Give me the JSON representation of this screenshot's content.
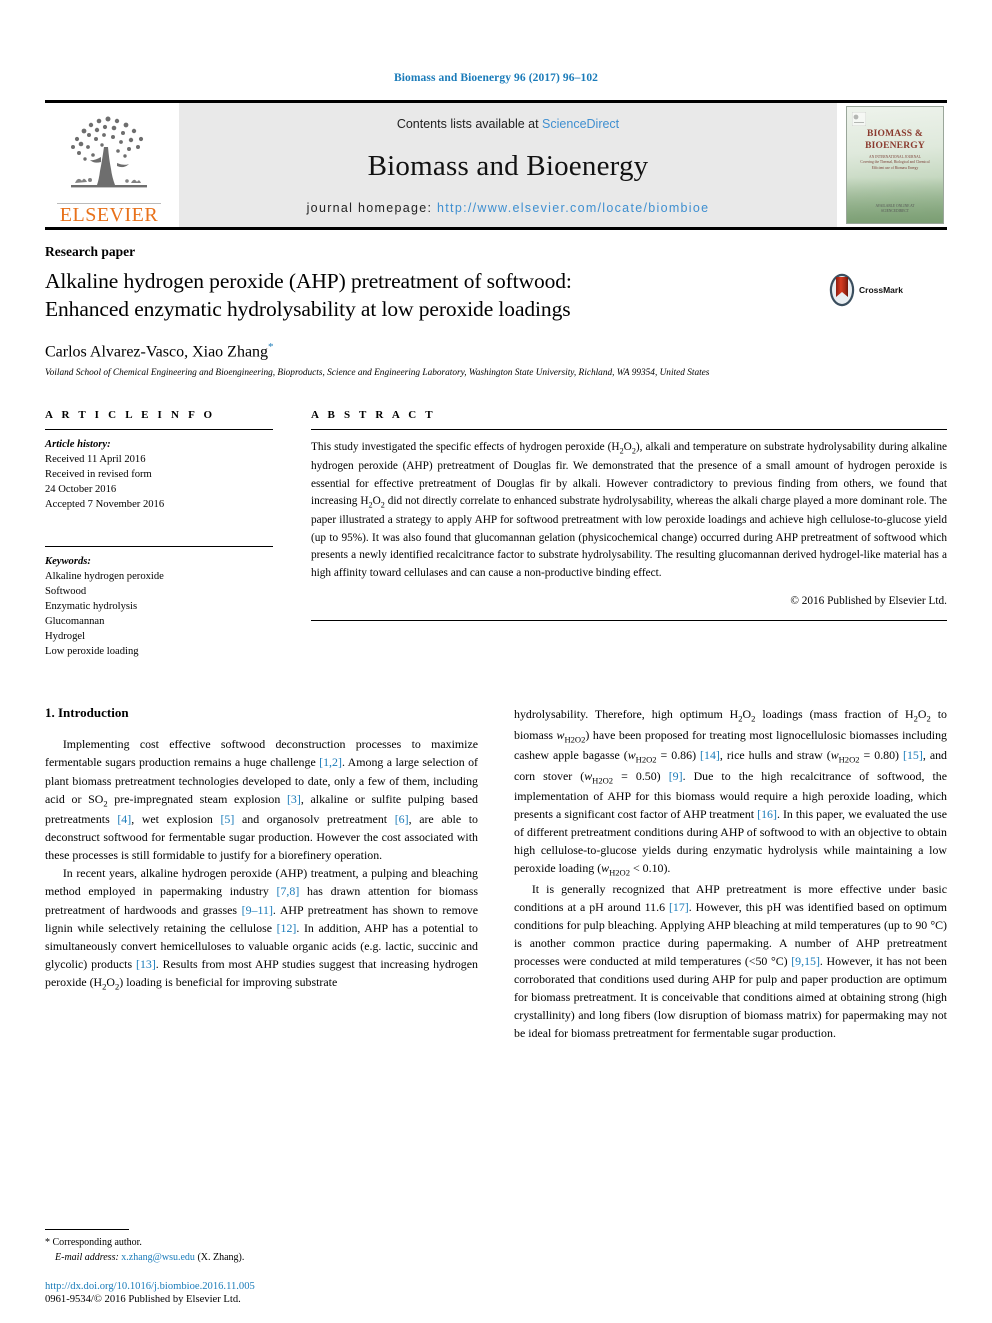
{
  "running_head": "Biomass and Bioenergy 96 (2017) 96–102",
  "masthead": {
    "contents_prefix": "Contents lists available at ",
    "sciencedirect": "ScienceDirect",
    "journal_name": "Biomass and Bioenergy",
    "homepage_prefix": "journal homepage: ",
    "homepage_url": "http://www.elsevier.com/locate/biombioe",
    "publisher_logo_text": "ELSEVIER",
    "cover_title_line1": "BIOMASS &",
    "cover_title_line2": "BIOENERGY",
    "cover_subtitle": "AN INTERNATIONAL JOURNAL",
    "cover_sub_detail": "Covering the Thermal, Biological and Chemical\nEfficient use of Biomass Energy",
    "cover_footer": "AVAILABLE ONLINE AT\nSCIENCEDIRECT"
  },
  "article": {
    "type": "Research paper",
    "title_line1": "Alkaline hydrogen peroxide (AHP) pretreatment of softwood:",
    "title_line2": "Enhanced enzymatic hydrolysability at low peroxide loadings",
    "crossmark_label": "CrossMark",
    "authors": "Carlos Alvarez-Vasco, Xiao Zhang",
    "corresponding_marker": "*",
    "affiliation": "Voiland School of Chemical Engineering and Bioengineering, Bioproducts, Science and Engineering Laboratory, Washington State University, Richland, WA 99354, United States"
  },
  "article_info": {
    "heading": "A R T I C L E   I N F O",
    "history_label": "Article history:",
    "history_lines": [
      "Received 11 April 2016",
      "Received in revised form",
      "24 October 2016",
      "Accepted 7 November 2016"
    ],
    "keywords_label": "Keywords:",
    "keywords": [
      "Alkaline hydrogen peroxide",
      "Softwood",
      "Enzymatic hydrolysis",
      "Glucomannan",
      "Hydrogel",
      "Low peroxide loading"
    ]
  },
  "abstract": {
    "heading": "A B S T R A C T",
    "text_part1": "This study investigated the specific effects of hydrogen peroxide (H",
    "text_sub1": "2",
    "text_part2": "O",
    "text_sub2": "2",
    "text_part3": "), alkali and temperature on substrate hydrolysability during alkaline hydrogen peroxide (AHP) pretreatment of Douglas fir. We demonstrated that the presence of a small amount of hydrogen peroxide is essential for effective pretreatment of Douglas fir by alkali. However contradictory to previous finding from others, we found that increasing H",
    "text_part4": "O",
    "text_part5": " did not directly correlate to enhanced substrate hydrolysability, whereas the alkali charge played a more dominant role. The paper illustrated a strategy to apply AHP for softwood pretreatment with low peroxide loadings and achieve high cellulose-to-glucose yield (up to 95%). It was also found that glucomannan gelation (physicochemical change) occurred during AHP pretreatment of softwood which presents a newly identified recalcitrance factor to substrate hydrolysability. The resulting glucomannan derived hydrogel-like material has a high affinity toward cellulases and can cause a non-productive binding effect.",
    "copyright": "© 2016 Published by Elsevier Ltd."
  },
  "body": {
    "section_number_title": "1.  Introduction",
    "left_paragraphs": [
      {
        "id": "p1",
        "runs": [
          {
            "t": "Implementing cost effective softwood deconstruction processes to maximize fermentable sugars production remains a huge challenge "
          },
          {
            "t": "[1,2]",
            "ref": true
          },
          {
            "t": ". Among a large selection of plant biomass pretreatment technologies developed to date, only a few of them, including acid or SO"
          },
          {
            "t": "2",
            "sub": true
          },
          {
            "t": " pre-impregnated steam explosion "
          },
          {
            "t": "[3]",
            "ref": true
          },
          {
            "t": ", alkaline or sulfite pulping based pretreatments "
          },
          {
            "t": "[4]",
            "ref": true
          },
          {
            "t": ", wet explosion "
          },
          {
            "t": "[5]",
            "ref": true
          },
          {
            "t": " and organosolv pretreatment "
          },
          {
            "t": "[6]",
            "ref": true
          },
          {
            "t": ", are able to deconstruct softwood for fermentable sugar production. However the cost associated with these processes is still formidable to justify for a biorefinery operation."
          }
        ]
      },
      {
        "id": "p2",
        "runs": [
          {
            "t": "In recent years, alkaline hydrogen peroxide (AHP) treatment, a pulping and bleaching method employed in papermaking industry "
          },
          {
            "t": "[7,8]",
            "ref": true
          },
          {
            "t": " has drawn attention for biomass pretreatment of hardwoods and grasses "
          },
          {
            "t": "[9–11]",
            "ref": true
          },
          {
            "t": ". AHP pretreatment has shown to remove lignin while selectively retaining the cellulose "
          },
          {
            "t": "[12]",
            "ref": true
          },
          {
            "t": ". In addition, AHP has a potential to simultaneously convert hemicelluloses to valuable organic acids (e.g. lactic, succinic and glycolic) products "
          },
          {
            "t": "[13]",
            "ref": true
          },
          {
            "t": ". Results from most AHP studies suggest that increasing hydrogen peroxide (H"
          },
          {
            "t": "2",
            "sub": true
          },
          {
            "t": "O"
          },
          {
            "t": "2",
            "sub": true
          },
          {
            "t": ") loading is beneficial for improving substrate"
          }
        ]
      }
    ],
    "right_paragraphs": [
      {
        "id": "p3",
        "noindent": true,
        "runs": [
          {
            "t": "hydrolysability. Therefore, high optimum H"
          },
          {
            "t": "2",
            "sub": true
          },
          {
            "t": "O"
          },
          {
            "t": "2",
            "sub": true
          },
          {
            "t": " loadings (mass fraction of H"
          },
          {
            "t": "2",
            "sub": true
          },
          {
            "t": "O"
          },
          {
            "t": "2",
            "sub": true
          },
          {
            "t": " to biomass "
          },
          {
            "t": "w",
            "italic": true
          },
          {
            "t": "H2O2",
            "sub": true
          },
          {
            "t": ") have been proposed for treating most lignocellulosic biomasses including cashew apple bagasse ("
          },
          {
            "t": "w",
            "italic": true
          },
          {
            "t": "H2O2",
            "sub": true
          },
          {
            "t": " = 0.86) "
          },
          {
            "t": "[14]",
            "ref": true
          },
          {
            "t": ", rice hulls and straw ("
          },
          {
            "t": "w",
            "italic": true
          },
          {
            "t": "H2O2",
            "sub": true
          },
          {
            "t": " = 0.80) "
          },
          {
            "t": "[15]",
            "ref": true
          },
          {
            "t": ", and corn stover ("
          },
          {
            "t": "w",
            "italic": true
          },
          {
            "t": "H2O2",
            "sub": true
          },
          {
            "t": " = 0.50) "
          },
          {
            "t": "[9]",
            "ref": true
          },
          {
            "t": ". Due to the high recalcitrance of softwood, the implementation of AHP for this biomass would require a high peroxide loading, which presents a significant cost factor of AHP treatment "
          },
          {
            "t": "[16]",
            "ref": true
          },
          {
            "t": ". In this paper, we evaluated the use of different pretreatment conditions during AHP of softwood to with an objective to obtain high cellulose-to-glucose yields during enzymatic hydrolysis while maintaining a low peroxide loading ("
          },
          {
            "t": "w",
            "italic": true
          },
          {
            "t": "H2O2",
            "sub": true
          },
          {
            "t": " < 0.10)."
          }
        ]
      },
      {
        "id": "p4",
        "runs": [
          {
            "t": "It is generally recognized that AHP pretreatment is more effective under basic conditions at a pH around 11.6 "
          },
          {
            "t": "[17]",
            "ref": true
          },
          {
            "t": ". However, this pH was identified based on optimum conditions for pulp bleaching. Applying AHP bleaching at mild temperatures (up to 90 °C) is another common practice during papermaking. A number of AHP pretreatment processes were conducted at mild temperatures (<50 °C) "
          },
          {
            "t": "[9,15]",
            "ref": true
          },
          {
            "t": ". However, it has not been corroborated that conditions used during AHP for pulp and paper production are optimum for biomass pretreatment. It is conceivable that conditions aimed at obtaining strong (high crystallinity) and long fibers (low disruption of biomass matrix) for papermaking may not be ideal for biomass pretreatment for fermentable sugar production."
          }
        ]
      }
    ]
  },
  "footer": {
    "corresponding_star": "*",
    "corresponding_text": "Corresponding author.",
    "email_label": "E-mail address:",
    "email": "x.zhang@wsu.edu",
    "email_suffix": "(X. Zhang).",
    "doi": "http://dx.doi.org/10.1016/j.biombioe.2016.11.005",
    "issn": "0961-9534/© 2016 Published by Elsevier Ltd."
  }
}
